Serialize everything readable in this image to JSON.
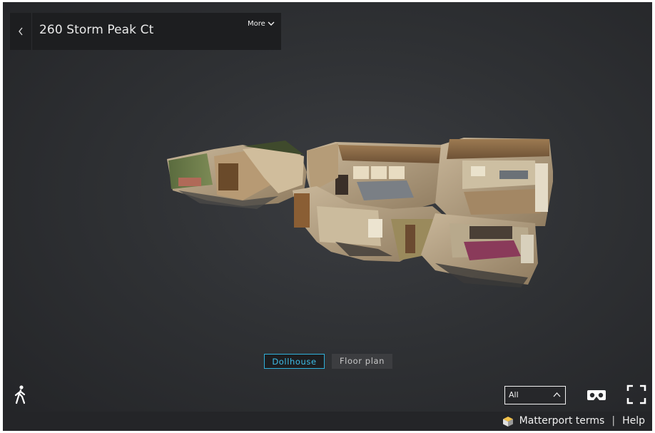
{
  "header": {
    "title": "260 Storm Peak Ct",
    "more_label": "More"
  },
  "view_modes": {
    "dollhouse_label": "Dollhouse",
    "floorplan_label": "Floor plan",
    "active": "Dollhouse"
  },
  "floor_select": {
    "selected": "All"
  },
  "footer": {
    "terms_label": "Matterport terms",
    "separator": "|",
    "help_label": "Help"
  },
  "colors": {
    "accent": "#3dbde8",
    "panel": "#1d1e20"
  },
  "icons": {
    "back": "chevron-left-icon",
    "more": "chevron-down-icon",
    "walk": "walking-person-icon",
    "floor_caret": "chevron-up-icon",
    "vr": "vr-headset-icon",
    "fullscreen": "fullscreen-icon",
    "logo": "matterport-cube-icon"
  }
}
